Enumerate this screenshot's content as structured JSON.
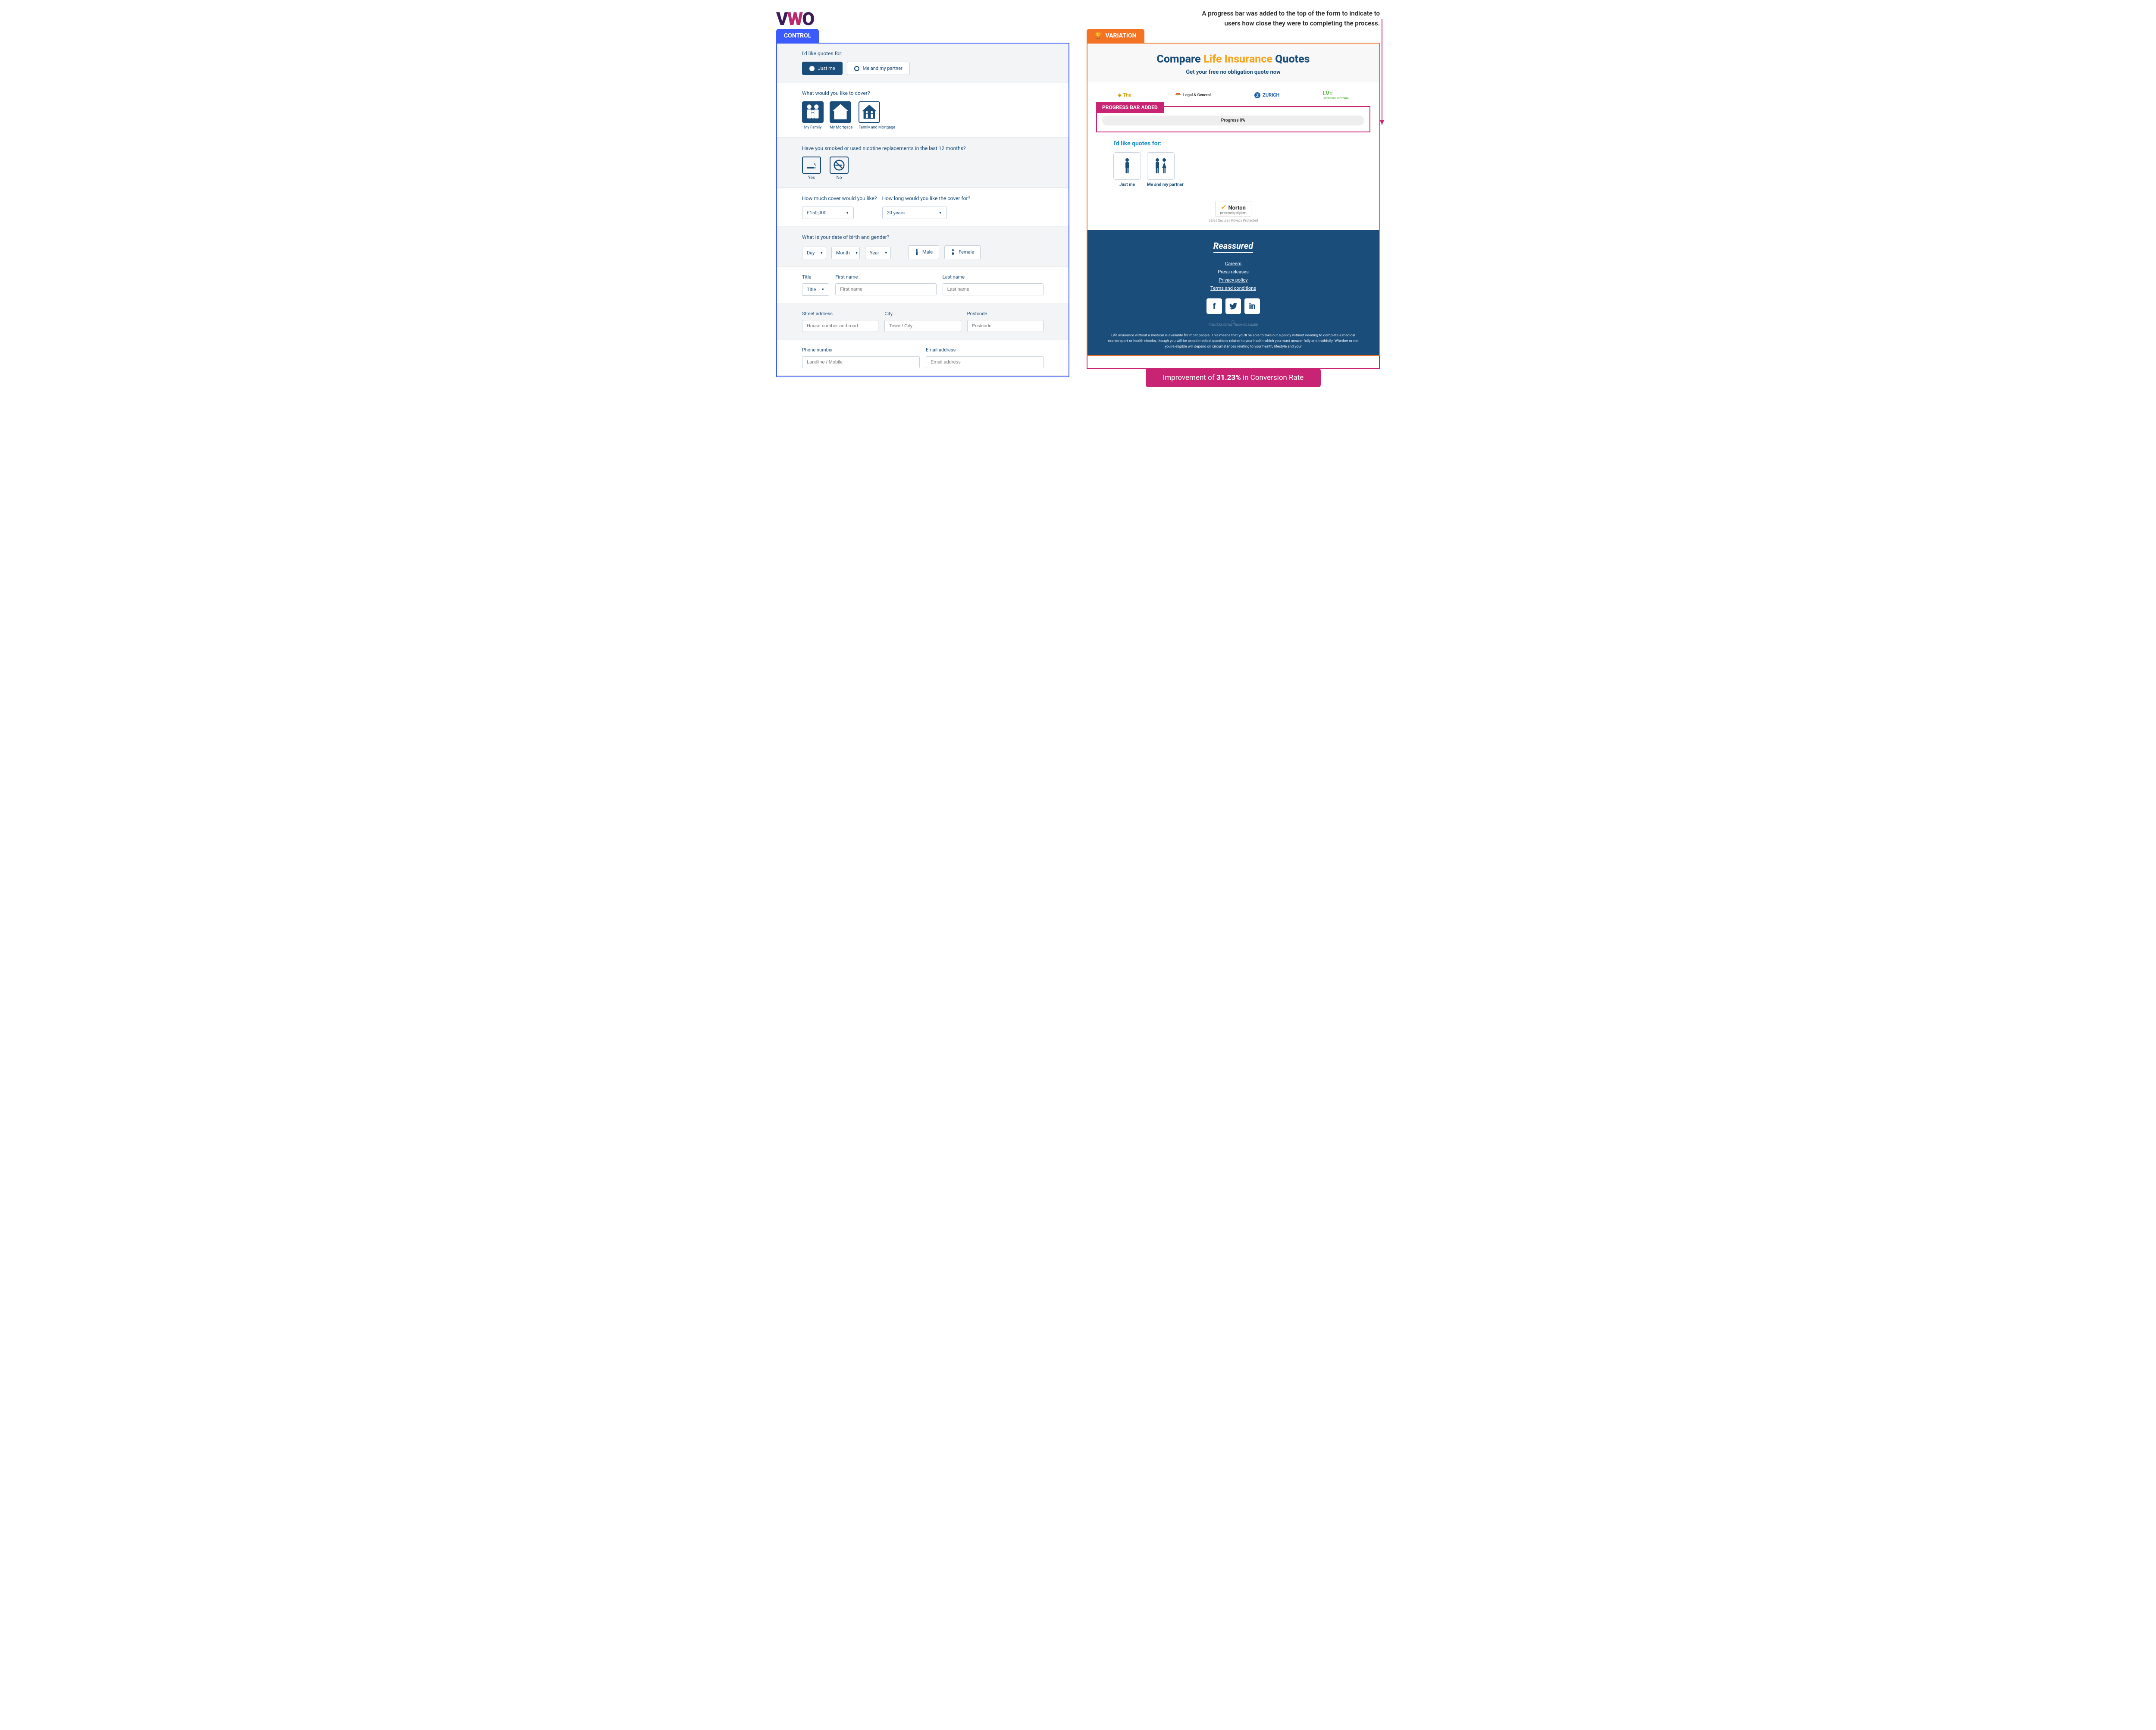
{
  "logo": {
    "p1": "V",
    "p2": "W",
    "p3": "O"
  },
  "annotation": "A progress bar was added to the top of the form to indicate to users how close they were to completing the process.",
  "control": {
    "tab": "CONTROL",
    "quotesFor": {
      "label": "I'd like quotes for:",
      "opt1": "Just me",
      "opt2": "Me and my partner"
    },
    "cover": {
      "label": "What would you like to cover?",
      "opts": [
        "My Family",
        "My Mortgage",
        "Family and Mortgage"
      ]
    },
    "smoke": {
      "label": "Have you smoked or used nicotine replacements in the last 12 months?",
      "yes": "Yes",
      "no": "No"
    },
    "amount": {
      "label1": "How much cover would you like?",
      "label2": "How long would you like the cover for?",
      "val1": "£150,000",
      "val2": "20 years"
    },
    "dob": {
      "label": "What is your date of birth and gender?",
      "day": "Day",
      "month": "Month",
      "year": "Year",
      "male": "Male",
      "female": "Female"
    },
    "name": {
      "title": "Title",
      "first": "First name",
      "last": "Last name",
      "titleVal": "Title",
      "firstPh": "First name",
      "lastPh": "Last name"
    },
    "addr": {
      "street": "Street address",
      "city": "City",
      "post": "Postcode",
      "streetPh": "House number and road",
      "cityPh": "Town / City",
      "postPh": "Postcode"
    },
    "contact": {
      "phone": "Phone number",
      "email": "Email address",
      "phonePh": "Landline / Mobile",
      "emailPh": "Email address"
    }
  },
  "variation": {
    "tab": "VARIATION",
    "title": {
      "p1": "Compare ",
      "p2": "Life Insurance ",
      "p3": "Quotes"
    },
    "sub": "Get your free no obligation quote now",
    "brands": {
      "lg": "Legal & General",
      "zurich": "ZURICH",
      "lv": "LV=",
      "lvSub": "LIVERPOOL VICTORIA",
      "the": "The"
    },
    "callout": "PROGRESS BAR ADDED",
    "progress": "Progress 0%",
    "quotesFor": {
      "label": "I'd like quotes for:",
      "opt1": "Just me",
      "opt2": "Me and my partner"
    },
    "norton": {
      "name": "Norton",
      "sub": "powered by digicert",
      "trust": "Safe | Secure | Privacy Protected"
    },
    "footer": {
      "brand": "Reassured",
      "links": [
        "Careers",
        "Press releases",
        "Privacy policy",
        "Terms and conditions"
      ],
      "award": "PRINCESS ROYAL TRAINING AWARD",
      "disclaimer": "Life insurance without a medical is available for most people. This means that you'll be able to take out a policy without needing to complete a medical exam/report or health checks, though you will be asked medical questions related to your health which you must answer fully and truthfully. Whether or not you're eligible will depend on circumstances relating to your health, lifestyle and your"
    }
  },
  "result": {
    "pre": "Improvement of ",
    "pct": "31.23%",
    "post": " in Conversion Rate"
  }
}
